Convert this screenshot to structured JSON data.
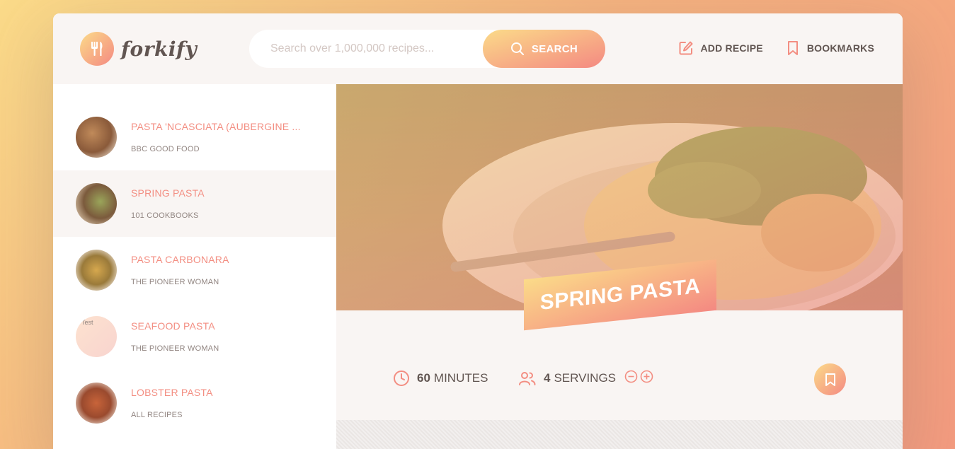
{
  "app": {
    "name": "forkify"
  },
  "search": {
    "placeholder": "Search over 1,000,000 recipes...",
    "button_label": "SEARCH"
  },
  "nav": {
    "add_recipe": "ADD RECIPE",
    "bookmarks": "BOOKMARKS"
  },
  "results": [
    {
      "title": "PASTA 'NCASCIATA (AUBERGINE ...",
      "publisher": "BBC GOOD FOOD",
      "active": false
    },
    {
      "title": "SPRING PASTA",
      "publisher": "101 COOKBOOKS",
      "active": true
    },
    {
      "title": "PASTA CARBONARA",
      "publisher": "THE PIONEER WOMAN",
      "active": false
    },
    {
      "title": "SEAFOOD PASTA",
      "publisher": "THE PIONEER WOMAN",
      "active": false,
      "broken_image_alt": "Test"
    },
    {
      "title": "LOBSTER PASTA",
      "publisher": "ALL RECIPES",
      "active": false
    }
  ],
  "recipe": {
    "title": "SPRING PASTA",
    "minutes_value": "60",
    "minutes_label": "MINUTES",
    "servings_value": "4",
    "servings_label": "SERVINGS"
  },
  "colors": {
    "accent_start": "#fbdb89",
    "accent_end": "#f48982",
    "text": "#615551"
  },
  "icons": [
    "fork-knife-icon",
    "search-icon",
    "edit-icon",
    "bookmark-icon",
    "clock-icon",
    "users-icon",
    "minus-circle-icon",
    "plus-circle-icon"
  ]
}
